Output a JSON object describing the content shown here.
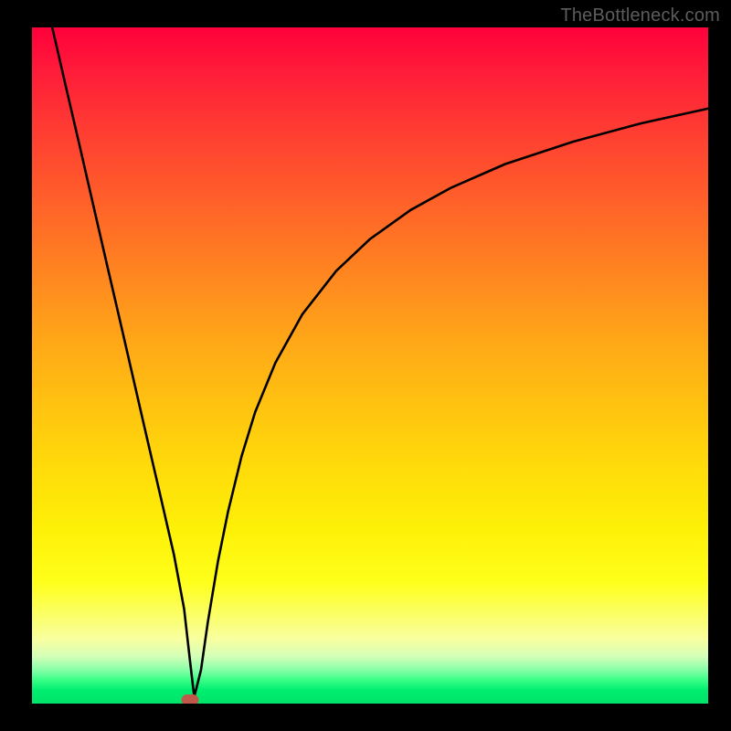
{
  "watermark": "TheBottleneck.com",
  "chart_data": {
    "type": "line",
    "title": "",
    "xlabel": "",
    "ylabel": "",
    "xlim": [
      0,
      100
    ],
    "ylim": [
      0,
      100
    ],
    "grid": false,
    "series": [
      {
        "name": "curve",
        "x": [
          3,
          5,
          7,
          9,
          11,
          13,
          15,
          17,
          19,
          21,
          22.5,
          23.4,
          24,
          25,
          26,
          27.5,
          29,
          31,
          33,
          36,
          40,
          45,
          50,
          56,
          62,
          70,
          80,
          90,
          100
        ],
        "values": [
          100,
          91.3,
          82.7,
          74.0,
          65.3,
          56.7,
          48.0,
          39.3,
          30.7,
          22.0,
          14.0,
          6.0,
          1.0,
          5.0,
          12.0,
          21.0,
          28.4,
          36.6,
          43.1,
          50.4,
          57.6,
          64.0,
          68.7,
          73.0,
          76.3,
          79.8,
          83.1,
          85.8,
          88.0
        ]
      }
    ],
    "marker": {
      "x": 23.4,
      "y": 0.5
    }
  },
  "colors": {
    "background": "#000000",
    "curve": "#000000",
    "marker": "#c1594b"
  }
}
